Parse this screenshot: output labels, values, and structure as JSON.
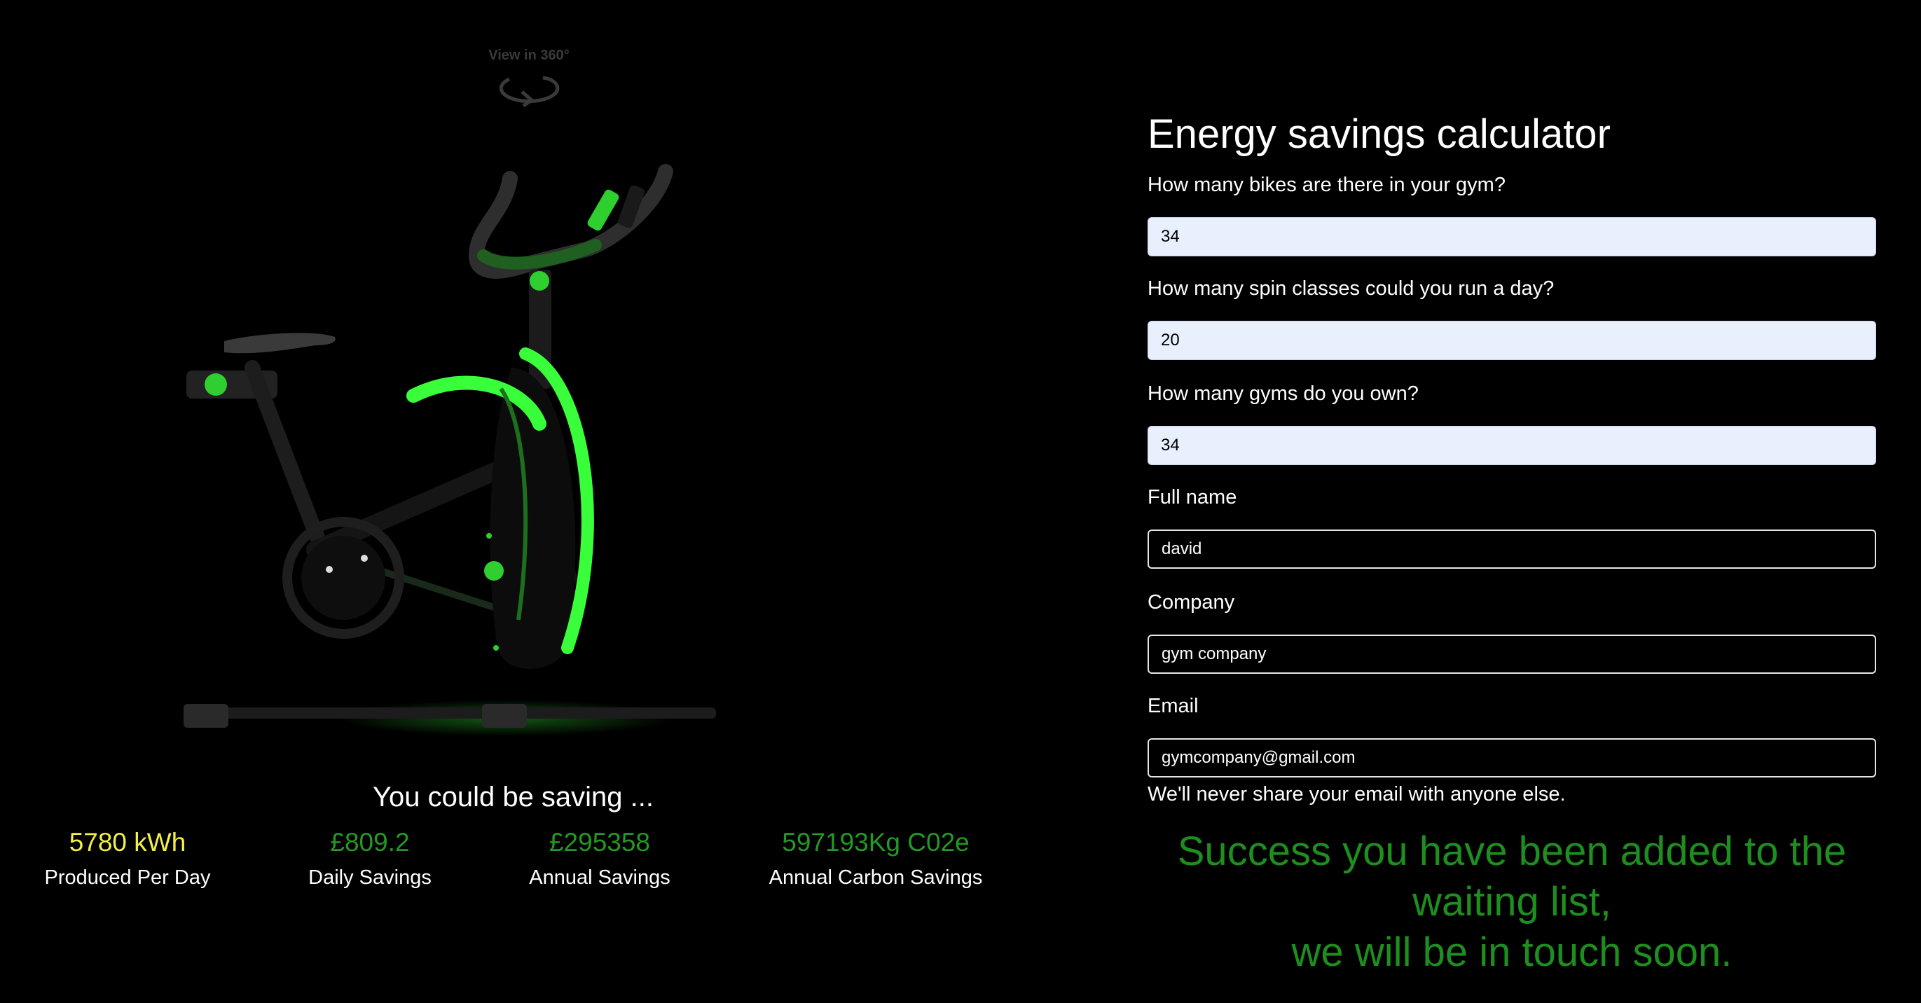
{
  "viewer": {
    "view_360_label": "View in 360°",
    "rotate_icon": "rotate-360-icon",
    "product_image": "spin-bike-with-green-lights"
  },
  "savings": {
    "heading": "You could be saving ...",
    "stats": [
      {
        "value": "5780 kWh",
        "label": "Produced Per Day",
        "color": "#f4f142"
      },
      {
        "value": "£809.2",
        "label": "Daily Savings",
        "color": "#239a23"
      },
      {
        "value": "£295358",
        "label": "Annual Savings",
        "color": "#239a23"
      },
      {
        "value": "597193Kg C02e",
        "label": "Annual Carbon Savings",
        "color": "#239a23"
      }
    ]
  },
  "form": {
    "title": "Energy savings calculator",
    "fields": [
      {
        "label": "How many bikes are there in your gym?",
        "value": "34"
      },
      {
        "label": "How many spin classes could you run a day?",
        "value": "20"
      },
      {
        "label": "How many gyms do you own?",
        "value": "34"
      },
      {
        "label": "Full name",
        "value": "david"
      },
      {
        "label": "Company",
        "value": "gym company"
      },
      {
        "label": "Email",
        "value": "gymcompany@gmail.com"
      }
    ],
    "email_help": "We'll never share your email with anyone else.",
    "success_line1": "Success you have been added to the",
    "success_line2": "waiting list,",
    "success_line3": "we will be in touch soon."
  },
  "colors": {
    "background": "#000000",
    "accent_green": "#239a23",
    "accent_yellow": "#f4f142",
    "bike_glow": "#39ff3a"
  }
}
